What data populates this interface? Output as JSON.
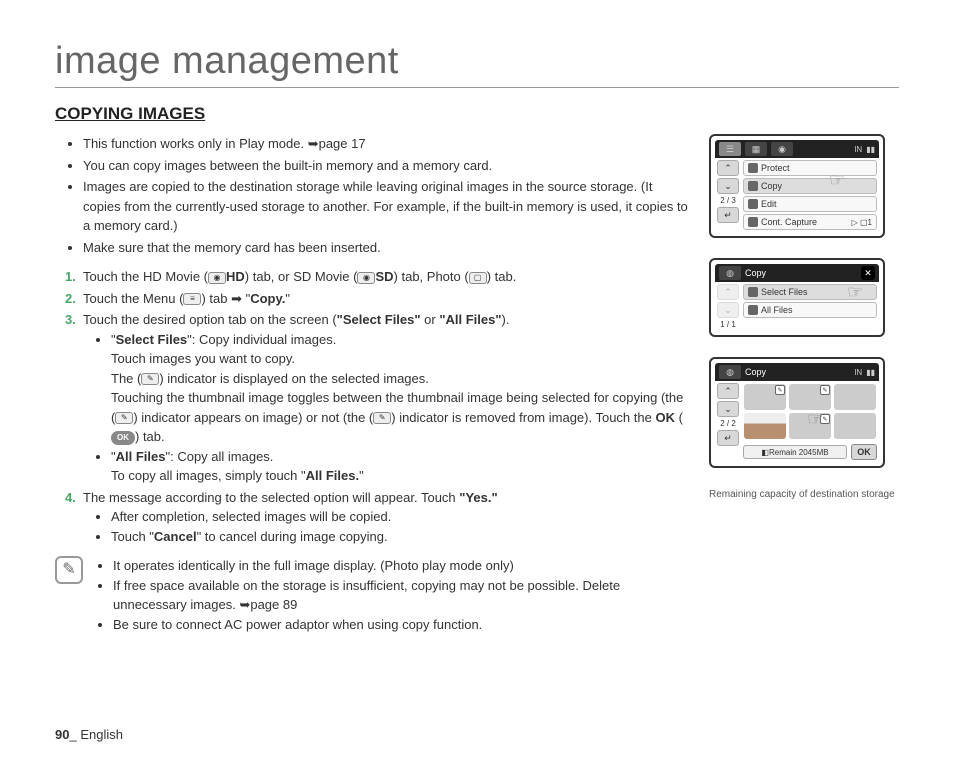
{
  "page": {
    "title": "image management",
    "section": "COPYING IMAGES",
    "footer_page": "90",
    "footer_sep": "_ ",
    "footer_lang": "English"
  },
  "bullets": [
    "This function works only in Play mode. ➥page 17",
    "You can copy images between the built-in memory and a memory card.",
    "Images are copied to the destination storage while leaving original images in the source storage. (It copies from the currently-used storage to another. For example, if the built-in memory is used, it copies to a memory card.)",
    "Make sure that the memory card has been inserted."
  ],
  "steps": {
    "s1_a": "Touch the HD Movie (",
    "s1_hd": "HD",
    "s1_b": ") tab, or SD Movie (",
    "s1_sd": "SD",
    "s1_c": ") tab, Photo (",
    "s1_d": ") tab.",
    "s2_a": "Touch the Menu (",
    "s2_b": ") tab ➡ \"",
    "s2_copy": "Copy.",
    "s2_c": "\"",
    "s3_a": "Touch the desired option tab on the screen (",
    "s3_sf": "\"Select Files\"",
    "s3_or": " or ",
    "s3_af": "\"All Files\"",
    "s3_b": ").",
    "s3_sub1_label": "Select Files",
    "s3_sub1_rest": "\": Copy individual images.",
    "s3_sub1_l2": "Touch images you want to copy.",
    "s3_sub1_l3a": "The (",
    "s3_sub1_l3b": ") indicator is displayed on the selected images.",
    "s3_sub1_l4a": "Touching the thumbnail image toggles between the thumbnail image being selected for copying (the (",
    "s3_sub1_l4b": ") indicator appears on image) or not (the (",
    "s3_sub1_l4c": ") indicator is removed from image). Touch the ",
    "s3_sub1_ok": "OK",
    "s3_sub1_l4d": " (",
    "s3_sub1_okpill": "OK",
    "s3_sub1_l4e": ") tab.",
    "s3_sub2_label": "All Files",
    "s3_sub2_rest": "\": Copy all images.",
    "s3_sub2_l2a": "To copy all images, simply touch \"",
    "s3_sub2_l2b": "All Files.",
    "s3_sub2_l2c": "\"",
    "s4_a": "The message according to the selected option will appear. Touch ",
    "s4_yes": "\"Yes.\"",
    "s4_sub1": "After completion, selected images will be copied.",
    "s4_sub2a": "Touch \"",
    "s4_cancel": "Cancel",
    "s4_sub2b": "\" to cancel during image copying.",
    "n1": "1.",
    "n2": "2.",
    "n3": "3.",
    "n4": "4."
  },
  "notes": [
    "It operates identically in the full image display. (Photo play mode only)",
    "If free space available on the storage is insufficient, copying may not be possible. Delete unnecessary images. ➥page 89",
    "Be sure to connect AC power adaptor when using copy function."
  ],
  "screen1": {
    "hdr_right1": "IN",
    "row1": "Protect",
    "row2": "Copy",
    "row3": "Edit",
    "row4": "Cont. Capture",
    "pager": "2 / 3"
  },
  "screen2": {
    "title": "Copy",
    "row1": "Select Files",
    "row2": "All Files",
    "pager": "1 / 1"
  },
  "screen3": {
    "title": "Copy",
    "hdr_right1": "IN",
    "pager": "2 / 2",
    "remain": "Remain 2045MB",
    "ok": "OK",
    "caption": "Remaining capacity of destination storage"
  }
}
